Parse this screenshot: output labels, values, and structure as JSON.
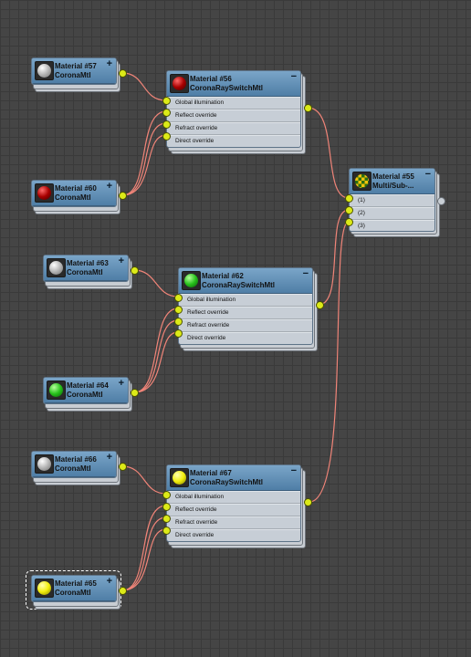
{
  "nodes": {
    "m57": {
      "title": "Material #57",
      "subtitle": "CoronaMtl",
      "control": "+",
      "swatch": "white-sphere-icon"
    },
    "m60": {
      "title": "Material #60",
      "subtitle": "CoronaMtl",
      "control": "+",
      "swatch": "red-sphere-icon"
    },
    "m63": {
      "title": "Material #63",
      "subtitle": "CoronaMtl",
      "control": "+",
      "swatch": "white-sphere-icon"
    },
    "m64": {
      "title": "Material #64",
      "subtitle": "CoronaMtl",
      "control": "+",
      "swatch": "green-sphere-icon"
    },
    "m66": {
      "title": "Material #66",
      "subtitle": "CoronaMtl",
      "control": "+",
      "swatch": "white-sphere-icon"
    },
    "m65": {
      "title": "Material #65",
      "subtitle": "CoronaMtl",
      "control": "+",
      "swatch": "yellow-sphere-icon"
    },
    "m56": {
      "title": "Material #56",
      "subtitle": "CoronaRaySwitchMtl",
      "control": "−",
      "swatch": "red-sphere-icon",
      "slots": [
        "Global illumination",
        "Reflect override",
        "Refract override",
        "Direct override"
      ]
    },
    "m62": {
      "title": "Material #62",
      "subtitle": "CoronaRaySwitchMtl",
      "control": "−",
      "swatch": "green-sphere-icon",
      "slots": [
        "Global illumination",
        "Reflect override",
        "Refract override",
        "Direct override"
      ]
    },
    "m67": {
      "title": "Material #67",
      "subtitle": "CoronaRaySwitchMtl",
      "control": "−",
      "swatch": "yellow-sphere-icon",
      "slots": [
        "Global illumination",
        "Reflect override",
        "Refract override",
        "Direct override"
      ]
    },
    "m55": {
      "title": "Material #55",
      "subtitle": "Multi/Sub-...",
      "control": "−",
      "swatch": "checker-icon",
      "slots": [
        "(1)",
        "(2)",
        "(3)"
      ]
    }
  },
  "colors": {
    "wire": "#f08478",
    "port": "#dcea18",
    "header": "#5f8db3",
    "background": "#454545"
  }
}
